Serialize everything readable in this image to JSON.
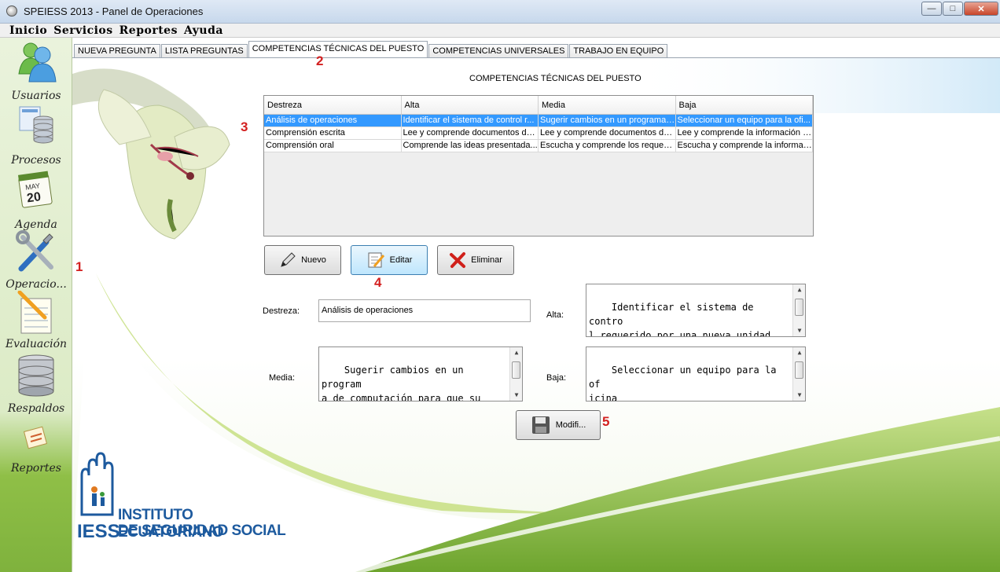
{
  "window": {
    "title": "SPEIESS 2013 - Panel de Operaciones"
  },
  "menu": [
    "Inicio",
    "Servicios",
    "Reportes",
    "Ayuda"
  ],
  "sidebar": [
    {
      "label": "Usuarios",
      "icon": "users-icon"
    },
    {
      "label": "Procesos",
      "icon": "database-icon"
    },
    {
      "label": "Agenda",
      "icon": "calendar-icon",
      "calendar_month": "MAY",
      "calendar_day": "20"
    },
    {
      "label": "Operacio...",
      "icon": "tools-icon"
    },
    {
      "label": "Evaluación",
      "icon": "notepad-icon"
    },
    {
      "label": "Respaldos",
      "icon": "backup-icon"
    },
    {
      "label": "Reportes",
      "icon": "report-icon"
    }
  ],
  "tabs": [
    {
      "label": "NUEVA PREGUNTA",
      "active": false
    },
    {
      "label": "LISTA PREGUNTAS",
      "active": false
    },
    {
      "label": "COMPETENCIAS TÉCNICAS DEL PUESTO",
      "active": true
    },
    {
      "label": "COMPETENCIAS UNIVERSALES",
      "active": false
    },
    {
      "label": "TRABAJO EN EQUIPO",
      "active": false
    }
  ],
  "section_title": "COMPETENCIAS TÉCNICAS DEL PUESTO",
  "table": {
    "columns": [
      "Destreza",
      "Alta",
      "Media",
      "Baja"
    ],
    "rows": [
      [
        "Análisis de operaciones",
        "Identificar el sistema de control r...",
        "Sugerir cambios en un programa ...",
        "Seleccionar un equipo para la ofi..."
      ],
      [
        "Comprensión escrita",
        "Lee y comprende documentos de...",
        "Lee y comprende documentos de...",
        "Lee y comprende la información s..."
      ],
      [
        "Comprensión oral",
        "Comprende las ideas presentada...",
        "Escucha y comprende los requeri...",
        "Escucha y comprende la informac..."
      ]
    ],
    "selected_row": 0
  },
  "buttons": {
    "new": "Nuevo",
    "edit": "Editar",
    "delete": "Eliminar",
    "modify": "Modifi..."
  },
  "form": {
    "destreza_label": "Destreza:",
    "destreza_value": "Análisis de operaciones",
    "alta_label": "Alta:",
    "alta_value": "Identificar el sistema de contro\nl requerido por una nueva unidad\n organizacional",
    "media_label": "Media:",
    "media_value": "Sugerir cambios en un program\na de computación para que su\nuso resulte más fácil al usua\nrio.",
    "baja_label": "Baja:",
    "baja_value": "Seleccionar un equipo para la of\nicina"
  },
  "annotations": [
    "1",
    "2",
    "3",
    "4",
    "5"
  ],
  "logo": {
    "line1": "INSTITUTO ECUATORIANO",
    "line2": "DE SEGURIDAD SOCIAL",
    "acronym": "IESS"
  },
  "colors": {
    "selection": "#3399ff",
    "annotation": "#d32020",
    "brand": "#1d5a9e",
    "sidebar_green": "#7fb23d"
  }
}
